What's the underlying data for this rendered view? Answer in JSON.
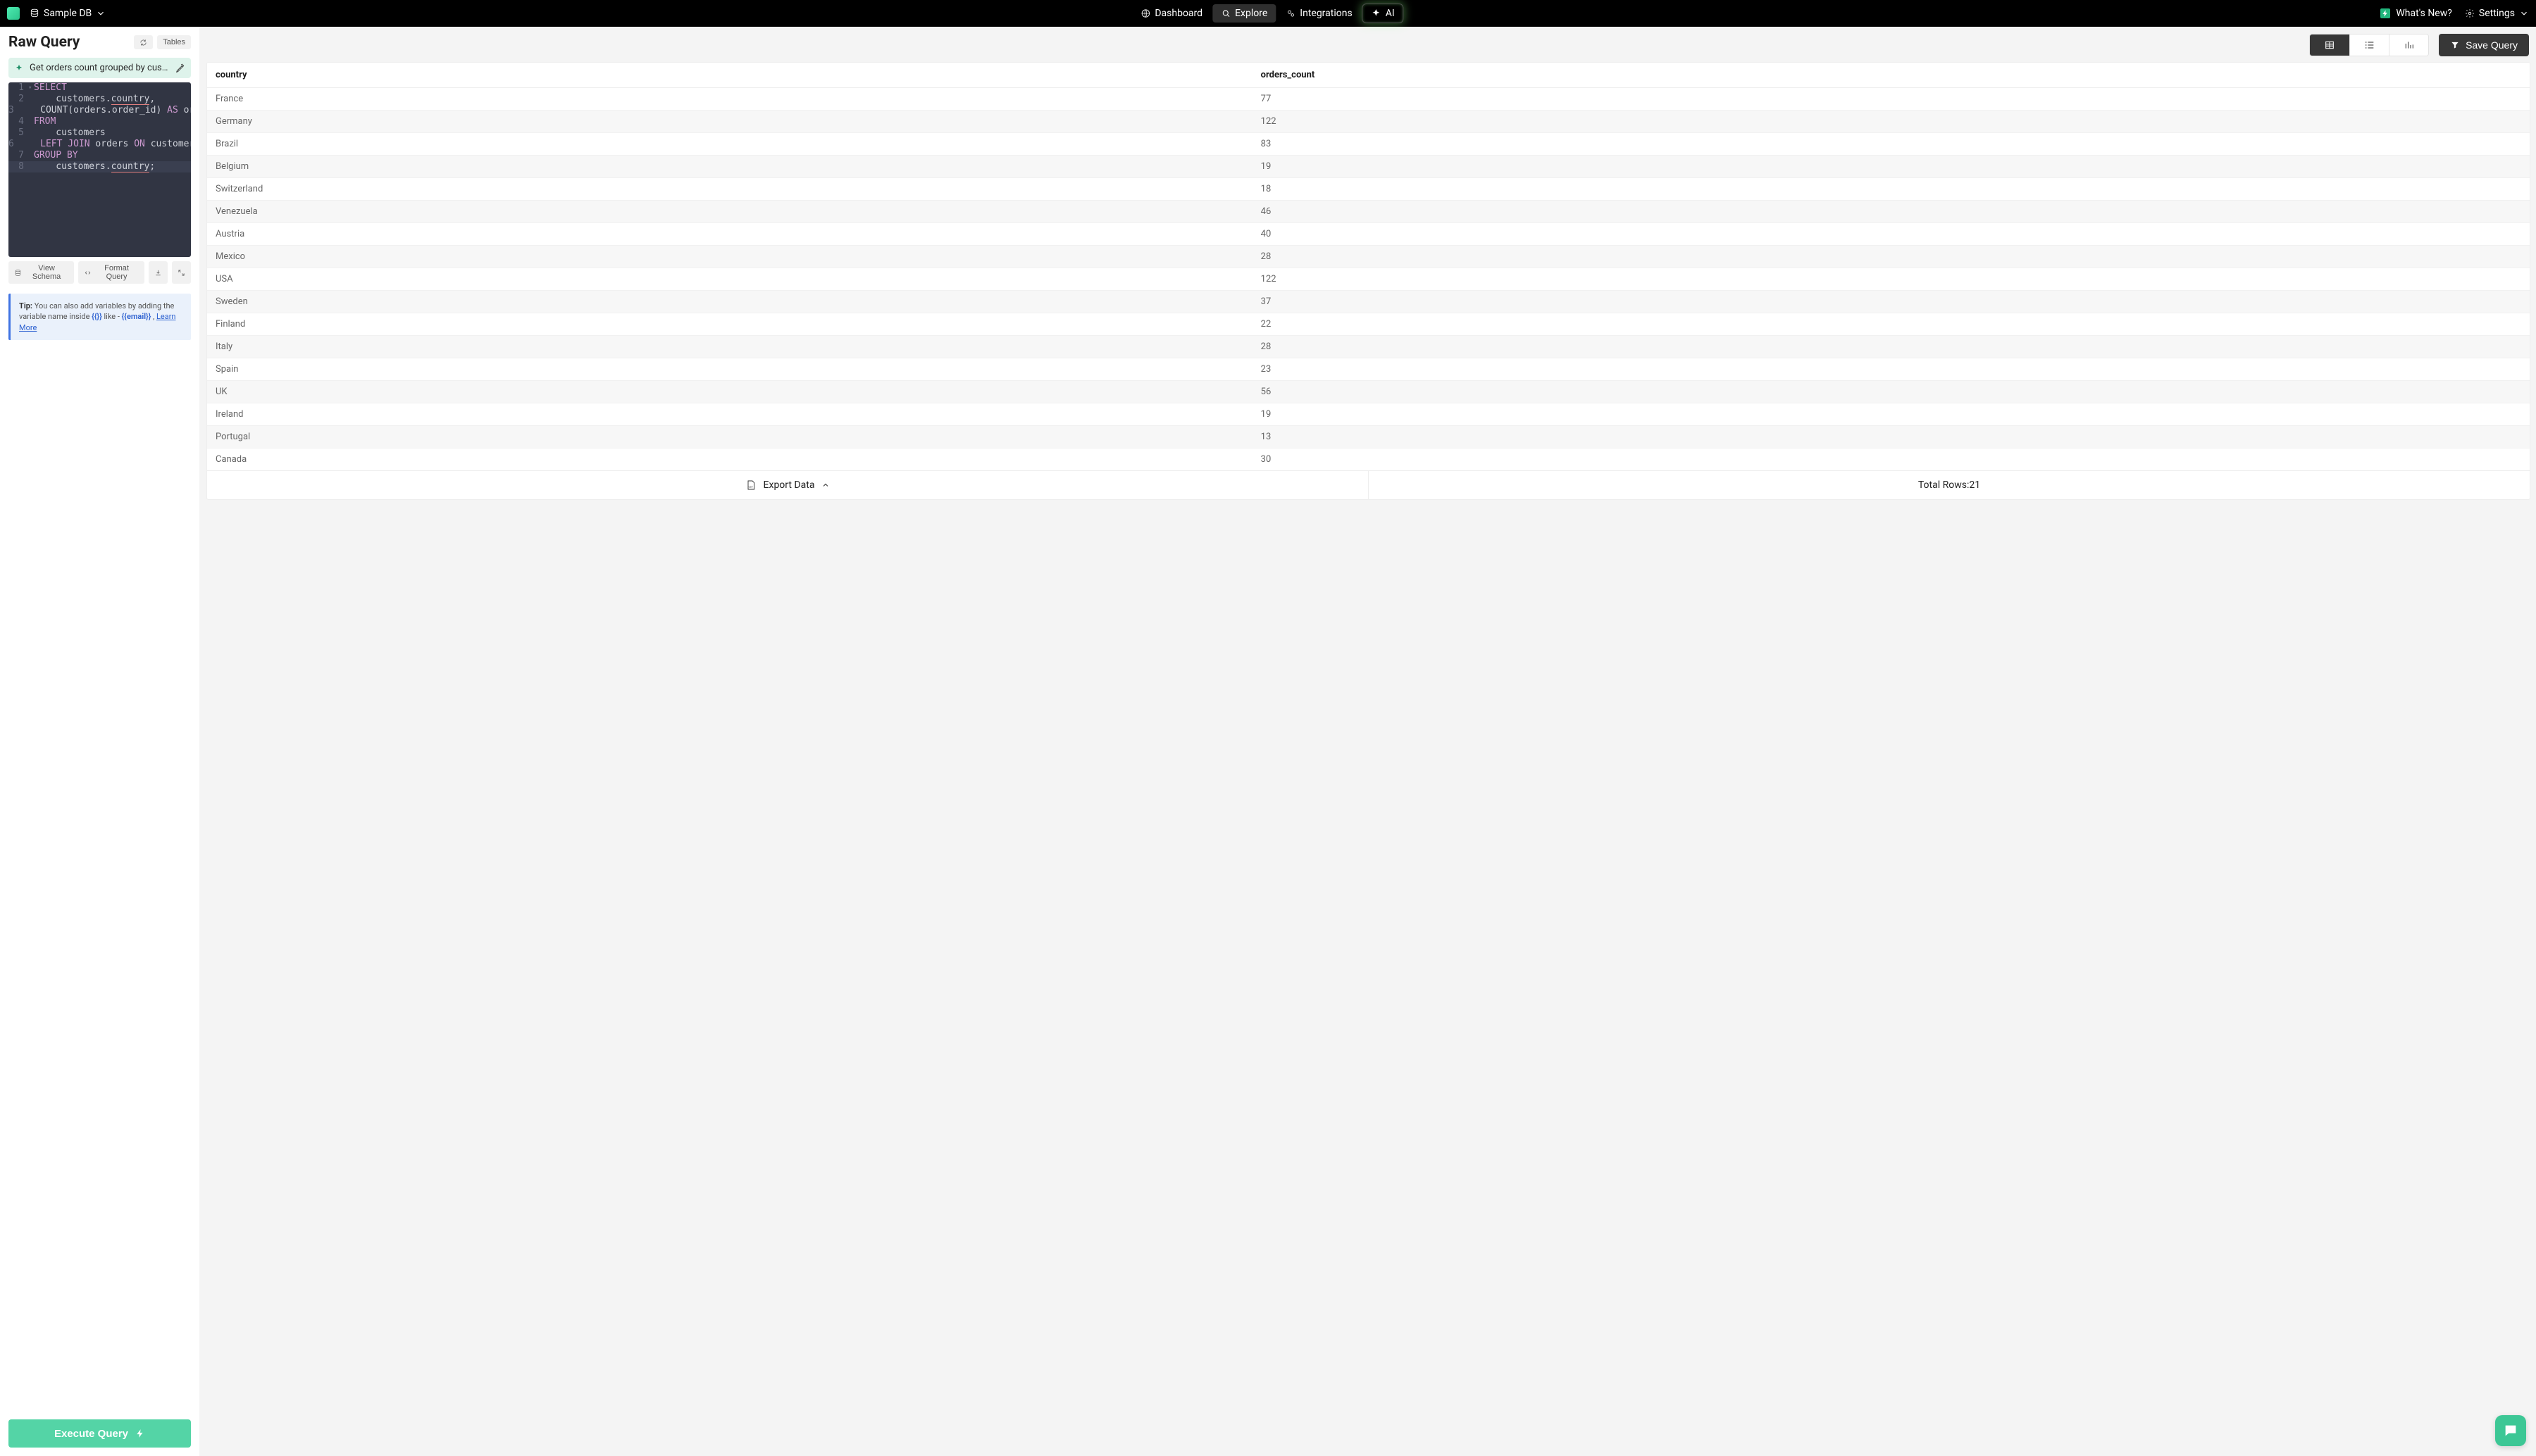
{
  "topbar": {
    "db_name": "Sample DB",
    "nav": {
      "dashboard": "Dashboard",
      "explore": "Explore",
      "integrations": "Integrations",
      "ai": "AI"
    },
    "whats_new": "What's New?",
    "settings": "Settings"
  },
  "left": {
    "title": "Raw Query",
    "tables_btn": "Tables",
    "prompt": "Get orders count grouped by cust…",
    "view_schema": "View Schema",
    "format_query": "Format Query",
    "tip_label": "Tip:",
    "tip_body_1": " You can also add variables by adding the variable name inside ",
    "tip_token1": "{{}}",
    "tip_like": " like - ",
    "tip_token2": "{{email}}",
    "tip_sep": " , ",
    "tip_link": "Learn More",
    "execute": "Execute Query",
    "code": {
      "l1_kw": "SELECT",
      "l2_pre": "    customers",
      "l2_dot": ".",
      "l2_col": "country",
      "l2_after": ",",
      "l3_pre": "    ",
      "l3_fn": "COUNT",
      "l3_open": "(",
      "l3_arg": "orders.order_id",
      "l3_close": ")",
      "l3_as": " AS ",
      "l3_alias": "orders",
      "l4_kw": "FROM",
      "l5_tbl": "    customers",
      "l6_pre": "    ",
      "l6_j1": "LEFT",
      "l6_j2": " JOIN ",
      "l6_t": "orders",
      "l6_on": " ON ",
      "l6_c": "customers.cu",
      "l7_g": "GROUP",
      "l7_b": " BY",
      "l8_pre": "    customers",
      "l8_dot": ".",
      "l8_col": "country",
      "l8_semi": ";"
    }
  },
  "main": {
    "save": "Save Query",
    "columns": {
      "country": "country",
      "orders_count": "orders_count"
    },
    "rows": [
      {
        "country": "France",
        "orders_count": "77"
      },
      {
        "country": "Germany",
        "orders_count": "122"
      },
      {
        "country": "Brazil",
        "orders_count": "83"
      },
      {
        "country": "Belgium",
        "orders_count": "19"
      },
      {
        "country": "Switzerland",
        "orders_count": "18"
      },
      {
        "country": "Venezuela",
        "orders_count": "46"
      },
      {
        "country": "Austria",
        "orders_count": "40"
      },
      {
        "country": "Mexico",
        "orders_count": "28"
      },
      {
        "country": "USA",
        "orders_count": "122"
      },
      {
        "country": "Sweden",
        "orders_count": "37"
      },
      {
        "country": "Finland",
        "orders_count": "22"
      },
      {
        "country": "Italy",
        "orders_count": "28"
      },
      {
        "country": "Spain",
        "orders_count": "23"
      },
      {
        "country": "UK",
        "orders_count": "56"
      },
      {
        "country": "Ireland",
        "orders_count": "19"
      },
      {
        "country": "Portugal",
        "orders_count": "13"
      },
      {
        "country": "Canada",
        "orders_count": "30"
      }
    ],
    "export": "Export Data",
    "total_rows_label": "Total Rows:",
    "total_rows_value": "21"
  }
}
